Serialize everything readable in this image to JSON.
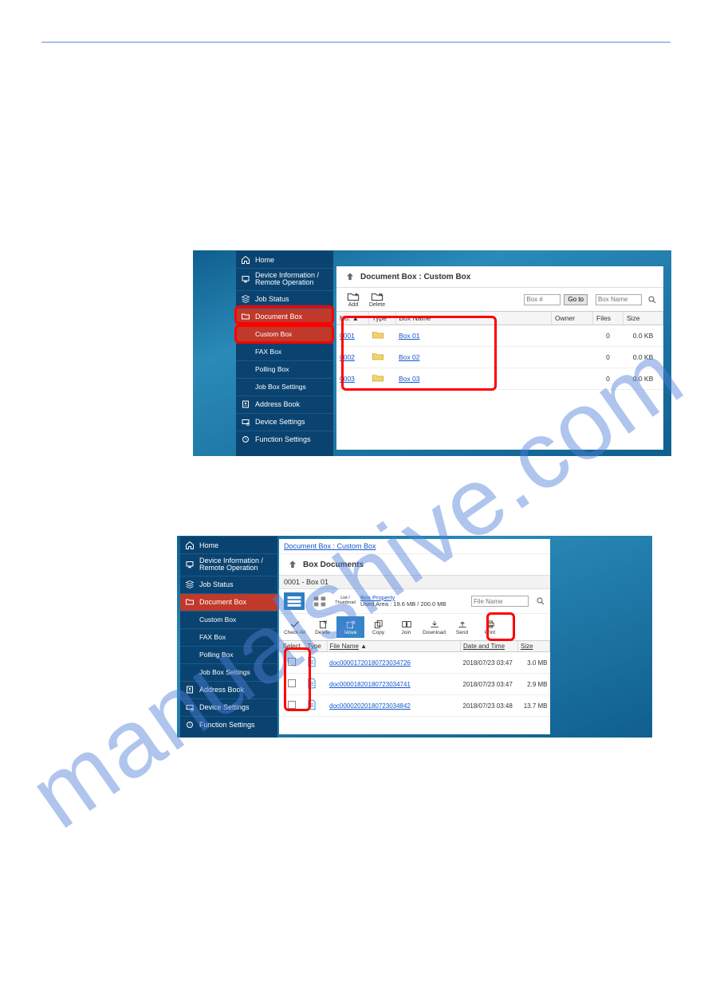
{
  "watermark": "manualshive.com",
  "sidebar": {
    "items": [
      {
        "label": "Home",
        "icon": "home-icon"
      },
      {
        "label": "Device Information / Remote Operation",
        "icon": "info-icon"
      },
      {
        "label": "Job Status",
        "icon": "status-icon"
      },
      {
        "label": "Document Box",
        "icon": "folder-icon"
      },
      {
        "label": "Address Book",
        "icon": "addressbook-icon"
      },
      {
        "label": "Device Settings",
        "icon": "settings-icon"
      },
      {
        "label": "Function Settings",
        "icon": "function-icon"
      }
    ],
    "sub": [
      {
        "label": "Custom Box"
      },
      {
        "label": "FAX Box"
      },
      {
        "label": "Polling Box"
      },
      {
        "label": "Job Box Settings"
      }
    ]
  },
  "panel1": {
    "title": "Document Box : Custom Box",
    "toolbar": {
      "add": "Add",
      "delete": "Delete",
      "box_num_placeholder": "Box #",
      "goto": "Go to",
      "boxname_placeholder": "Box Name"
    },
    "columns": {
      "no": "No.",
      "type": "Type",
      "boxname": "Box Name",
      "owner": "Owner",
      "files": "Files",
      "size": "Size"
    },
    "rows": [
      {
        "no": "0001",
        "name": "Box 01",
        "owner": "",
        "files": "0",
        "size": "0.0 KB"
      },
      {
        "no": "0002",
        "name": "Box 02",
        "owner": "",
        "files": "0",
        "size": "0.0 KB"
      },
      {
        "no": "0003",
        "name": "Box 03",
        "owner": "",
        "files": "0",
        "size": "0.0 KB"
      }
    ]
  },
  "panel2": {
    "breadcrumb": "Document Box : Custom Box",
    "title": "Box Documents",
    "subtitle": "0001 - Box 01",
    "view_list": "List",
    "view_thumb": "Thumbnail",
    "prop_link": "Box Property",
    "used_area": "Used Area : 19.6 MB / 200.0 MB",
    "filename_placeholder": "File Name",
    "actions": {
      "checkall": "Check All",
      "delete": "Delete",
      "move": "Move",
      "copy": "Copy",
      "join": "Join",
      "download": "Download",
      "send": "Send",
      "print": "Print"
    },
    "columns": {
      "select": "Select",
      "type": "Type",
      "filename": "File Name",
      "datetime": "Date and Time",
      "size": "Size"
    },
    "rows": [
      {
        "name": "doc00001720180723034726",
        "date": "2018/07/23 03:47",
        "size": "3.0 MB"
      },
      {
        "name": "doc00001820180723034741",
        "date": "2018/07/23 03:47",
        "size": "2.9 MB"
      },
      {
        "name": "doc00002020180723034842",
        "date": "2018/07/23 03:48",
        "size": "13.7 MB"
      }
    ]
  }
}
